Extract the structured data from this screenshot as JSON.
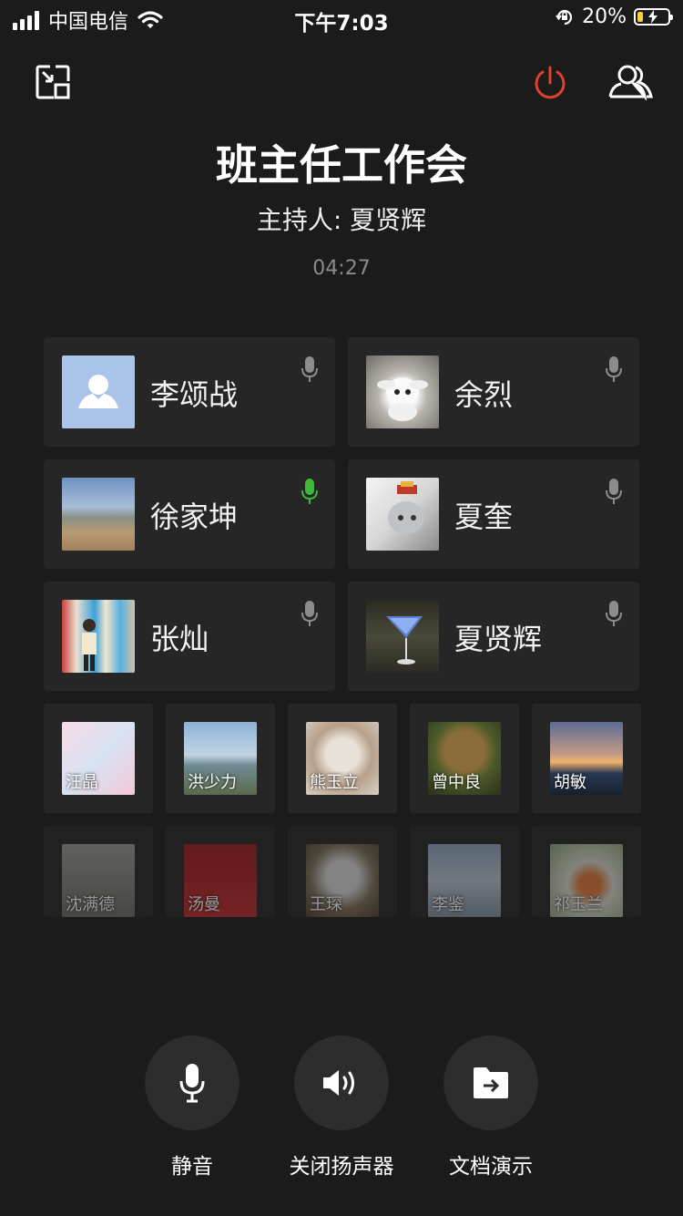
{
  "status_bar": {
    "carrier": "中国电信",
    "time": "下午7:03",
    "battery_percent": "20%",
    "battery_level": 0.2
  },
  "meeting": {
    "title": "班主任工作会",
    "host_text": "主持人: 夏贤辉",
    "duration": "04:27"
  },
  "speakers": [
    {
      "name": "李颂战",
      "speaking": false,
      "avatar": "default-person"
    },
    {
      "name": "余烈",
      "speaking": false,
      "avatar": "photo"
    },
    {
      "name": "徐家坤",
      "speaking": true,
      "avatar": "photo"
    },
    {
      "name": "夏奎",
      "speaking": false,
      "avatar": "photo"
    },
    {
      "name": "张灿",
      "speaking": false,
      "avatar": "photo"
    },
    {
      "name": "夏贤辉",
      "speaking": false,
      "avatar": "photo"
    }
  ],
  "participants_row1": [
    "汪晶",
    "洪少力",
    "熊玉立",
    "曾中良",
    "胡敏"
  ],
  "participants_row2": [
    "沈满德",
    "汤曼",
    "王琛",
    "李鉴",
    "祁玉兰"
  ],
  "controls": {
    "mute": "静音",
    "speaker_off": "关闭扬声器",
    "share_doc": "文档演示"
  },
  "colors": {
    "background": "#1b1b1b",
    "card": "#262626",
    "speaking_mic": "#3fb73c",
    "idle_mic": "#8c8c8c",
    "hangup": "#e0412f"
  }
}
